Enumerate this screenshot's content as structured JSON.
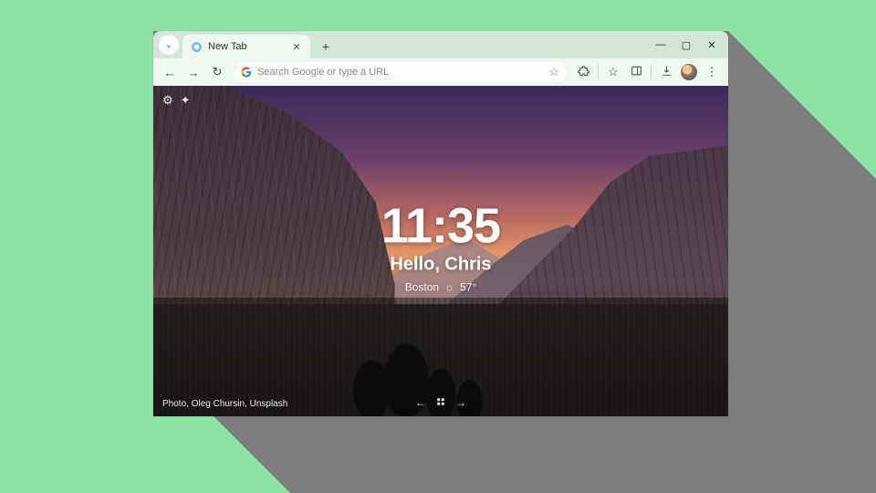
{
  "tab": {
    "title": "New Tab"
  },
  "omnibox": {
    "placeholder": "Search Google or type a URL"
  },
  "newtab": {
    "time": "11:35",
    "greeting": "Hello, Chris",
    "weather": {
      "location": "Boston",
      "temp": "57°"
    },
    "credit": "Photo, Oleg Chursin, Unsplash"
  }
}
